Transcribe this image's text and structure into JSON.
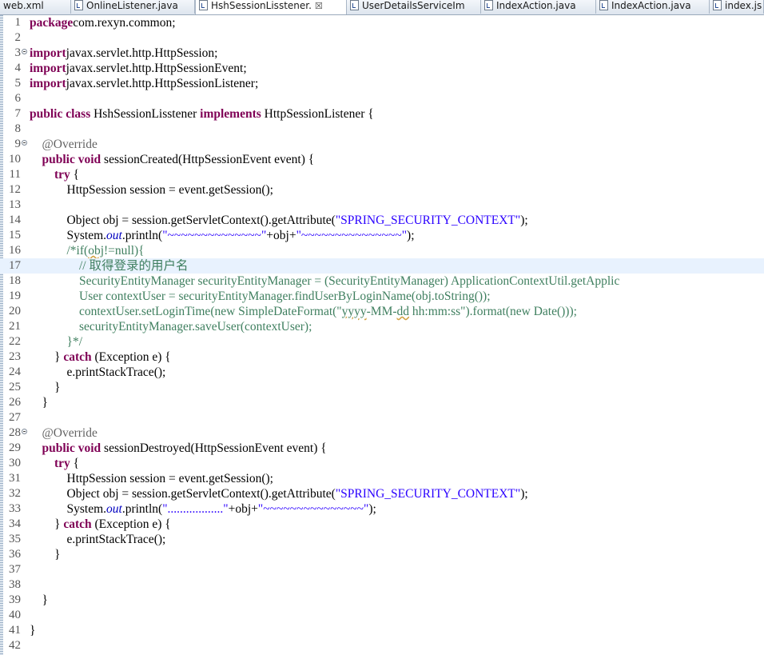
{
  "tabs": [
    {
      "label": "web.xml",
      "active": false,
      "closable": false
    },
    {
      "label": "OnlineListener.java",
      "active": false,
      "closable": false
    },
    {
      "label": "HshSessionLisstener.",
      "active": true,
      "closable": true
    },
    {
      "label": "UserDetailsServiceIm",
      "active": false,
      "closable": false
    },
    {
      "label": "IndexAction.java",
      "active": false,
      "closable": false
    },
    {
      "label": "IndexAction.java",
      "active": false,
      "closable": false
    },
    {
      "label": "index.js",
      "active": false,
      "closable": false
    }
  ],
  "close_glyph": "☒",
  "editor": {
    "current_line": 17,
    "lines": [
      {
        "n": "1",
        "t": [
          [
            "k",
            "package"
          ],
          [
            "",
            "com.rexyn.common;"
          ]
        ]
      },
      {
        "n": "2",
        "t": []
      },
      {
        "n": "3",
        "fold": true,
        "t": [
          [
            "k",
            "import"
          ],
          [
            "",
            "javax.servlet.http.HttpSession;"
          ]
        ]
      },
      {
        "n": "4",
        "t": [
          [
            "k",
            "import"
          ],
          [
            "",
            "javax.servlet.http.HttpSessionEvent;"
          ]
        ]
      },
      {
        "n": "5",
        "t": [
          [
            "k",
            "import"
          ],
          [
            "",
            "javax.servlet.http.HttpSessionListener;"
          ]
        ]
      },
      {
        "n": "6",
        "t": []
      },
      {
        "n": "7",
        "t": [
          [
            "k",
            "public"
          ],
          [
            "",
            " "
          ],
          [
            "k",
            "class"
          ],
          [
            "",
            " HshSessionLisstener "
          ],
          [
            "k",
            "implements"
          ],
          [
            "",
            " HttpSessionListener {"
          ]
        ]
      },
      {
        "n": "8",
        "t": []
      },
      {
        "n": "9",
        "fold": true,
        "t": [
          [
            "",
            "    "
          ],
          [
            "a",
            "@Override"
          ]
        ]
      },
      {
        "n": "10",
        "t": [
          [
            "",
            "    "
          ],
          [
            "k",
            "public"
          ],
          [
            "",
            " "
          ],
          [
            "k",
            "void"
          ],
          [
            "",
            " sessionCreated(HttpSessionEvent event) {"
          ]
        ]
      },
      {
        "n": "11",
        "t": [
          [
            "",
            "        "
          ],
          [
            "k",
            "try"
          ],
          [
            "",
            " {"
          ]
        ]
      },
      {
        "n": "12",
        "t": [
          [
            "",
            "            HttpSession session = event.getSession();"
          ]
        ]
      },
      {
        "n": "13",
        "t": []
      },
      {
        "n": "14",
        "t": [
          [
            "",
            "            Object obj = session.getServletContext().getAttribute("
          ],
          [
            "s",
            "\"SPRING_SECURITY_CONTEXT\""
          ],
          [
            "",
            ");"
          ]
        ]
      },
      {
        "n": "15",
        "t": [
          [
            "",
            "            System."
          ],
          [
            "f",
            "out"
          ],
          [
            "",
            ".println("
          ],
          [
            "s",
            "\"~~~~~~~~~~~~~~\""
          ],
          [
            "",
            "+obj+"
          ],
          [
            "s",
            "\"~~~~~~~~~~~~~~~\""
          ],
          [
            "",
            ");"
          ]
        ]
      },
      {
        "n": "16",
        "t": [
          [
            "",
            "            "
          ],
          [
            "c",
            "/*if("
          ],
          [
            "cw",
            "obj"
          ],
          [
            "c",
            "!=null){"
          ]
        ]
      },
      {
        "n": "17",
        "t": [
          [
            "",
            "                "
          ],
          [
            "c",
            "// 取得登录的用户名"
          ]
        ]
      },
      {
        "n": "18",
        "t": [
          [
            "",
            "                "
          ],
          [
            "c",
            "SecurityEntityManager securityEntityManager = (SecurityEntityManager) ApplicationContextUtil.getApplic"
          ]
        ]
      },
      {
        "n": "19",
        "t": [
          [
            "",
            "                "
          ],
          [
            "c",
            "User contextUser = securityEntityManager.findUserByLoginName(obj.toString());"
          ]
        ]
      },
      {
        "n": "20",
        "t": [
          [
            "",
            "                "
          ],
          [
            "c",
            "contextUser.setLoginTime(new SimpleDateFormat(\""
          ],
          [
            "cw",
            "yyyy"
          ],
          [
            "c",
            "-MM-"
          ],
          [
            "cw",
            "dd"
          ],
          [
            "c",
            " hh:mm:ss\").format(new Date()));"
          ]
        ]
      },
      {
        "n": "21",
        "t": [
          [
            "",
            "                "
          ],
          [
            "c",
            "securityEntityManager.saveUser(contextUser);"
          ]
        ]
      },
      {
        "n": "22",
        "t": [
          [
            "",
            "            "
          ],
          [
            "c",
            "}*/"
          ]
        ]
      },
      {
        "n": "23",
        "t": [
          [
            "",
            "        } "
          ],
          [
            "k",
            "catch"
          ],
          [
            "",
            " (Exception e) {"
          ]
        ]
      },
      {
        "n": "24",
        "t": [
          [
            "",
            "            e.printStackTrace();"
          ]
        ]
      },
      {
        "n": "25",
        "t": [
          [
            "",
            "        }"
          ]
        ]
      },
      {
        "n": "26",
        "t": [
          [
            "",
            "    }"
          ]
        ]
      },
      {
        "n": "27",
        "t": []
      },
      {
        "n": "28",
        "fold": true,
        "t": [
          [
            "",
            "    "
          ],
          [
            "a",
            "@Override"
          ]
        ]
      },
      {
        "n": "29",
        "t": [
          [
            "",
            "    "
          ],
          [
            "k",
            "public"
          ],
          [
            "",
            " "
          ],
          [
            "k",
            "void"
          ],
          [
            "",
            " sessionDestroyed(HttpSessionEvent event) {"
          ]
        ]
      },
      {
        "n": "30",
        "t": [
          [
            "",
            "        "
          ],
          [
            "k",
            "try"
          ],
          [
            "",
            " {"
          ]
        ]
      },
      {
        "n": "31",
        "t": [
          [
            "",
            "            HttpSession session = event.getSession();"
          ]
        ]
      },
      {
        "n": "32",
        "t": [
          [
            "",
            "            Object obj = session.getServletContext().getAttribute("
          ],
          [
            "s",
            "\"SPRING_SECURITY_CONTEXT\""
          ],
          [
            "",
            ");"
          ]
        ]
      },
      {
        "n": "33",
        "t": [
          [
            "",
            "            System."
          ],
          [
            "f",
            "out"
          ],
          [
            "",
            ".println("
          ],
          [
            "s",
            "\"..................\""
          ],
          [
            "",
            "+obj+"
          ],
          [
            "s",
            "\"~~~~~~~~~~~~~~~\""
          ],
          [
            "",
            ");"
          ]
        ]
      },
      {
        "n": "34",
        "t": [
          [
            "",
            "        } "
          ],
          [
            "k",
            "catch"
          ],
          [
            "",
            " (Exception e) {"
          ]
        ]
      },
      {
        "n": "35",
        "t": [
          [
            "",
            "            e.printStackTrace();"
          ]
        ]
      },
      {
        "n": "36",
        "t": [
          [
            "",
            "        }"
          ]
        ]
      },
      {
        "n": "37",
        "t": []
      },
      {
        "n": "38",
        "t": []
      },
      {
        "n": "39",
        "t": [
          [
            "",
            "    }"
          ]
        ]
      },
      {
        "n": "40",
        "t": []
      },
      {
        "n": "41",
        "t": [
          [
            "",
            "}"
          ]
        ]
      },
      {
        "n": "42",
        "t": []
      }
    ]
  }
}
